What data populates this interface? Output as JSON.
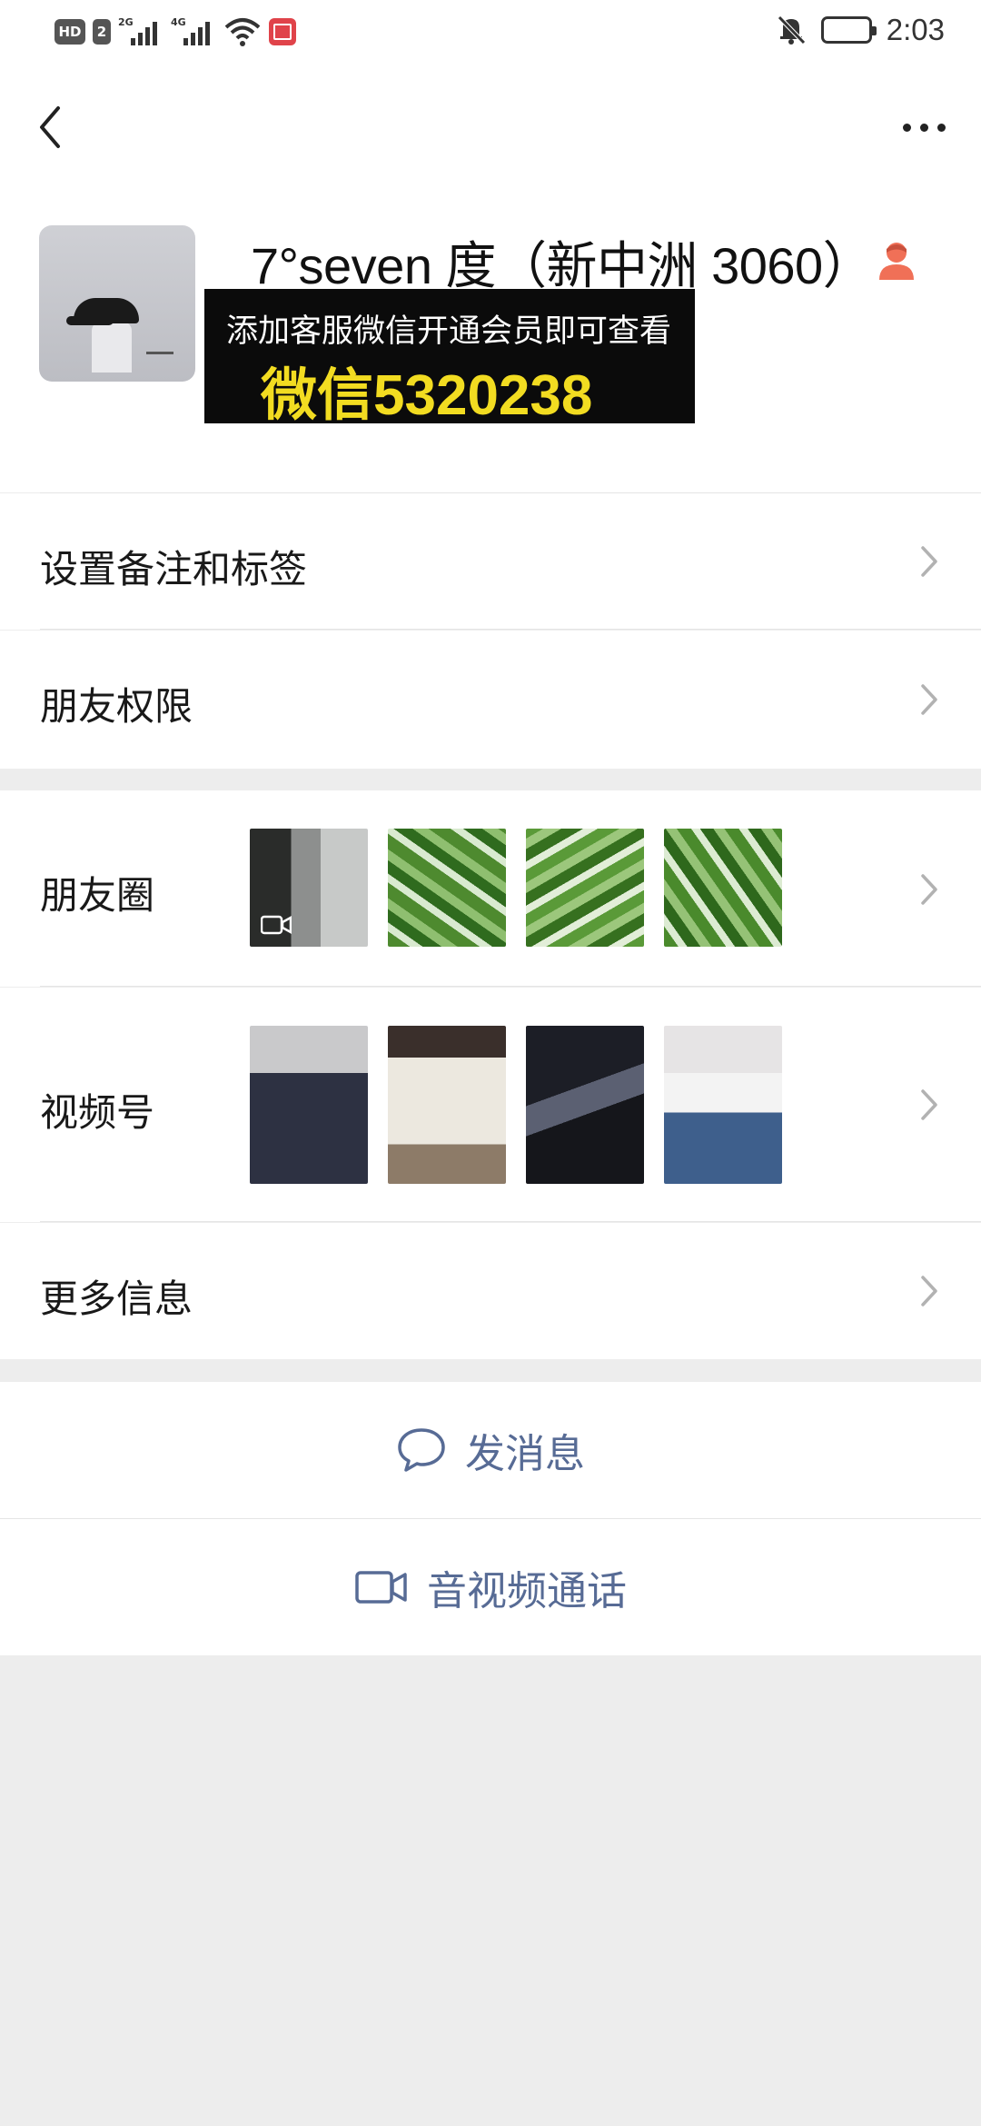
{
  "status_bar": {
    "hd_label": "HD",
    "sim_label": "2",
    "sig1_label": "2G",
    "sig2_label": "4G",
    "time": "2:03"
  },
  "profile": {
    "display_name": "7°seven 度（新中洲 3060）",
    "promo_line1": "添加客服微信开通会员即可查看",
    "promo_line2": "微信5320238"
  },
  "rows": {
    "remark_tags": "设置备注和标签",
    "friend_permissions": "朋友权限",
    "moments": "朋友圈",
    "channels": "视频号",
    "more_info": "更多信息"
  },
  "actions": {
    "send_message": "发消息",
    "video_call": "音视频通话"
  },
  "colors": {
    "link_blue": "#576b95",
    "promo_yellow": "#f2dc21",
    "page_gray": "#ededed"
  },
  "icons": [
    "back-arrow-icon",
    "more-dots-icon",
    "gender-female-icon",
    "chevron-right-icon",
    "chat-bubble-icon",
    "video-camera-icon"
  ]
}
